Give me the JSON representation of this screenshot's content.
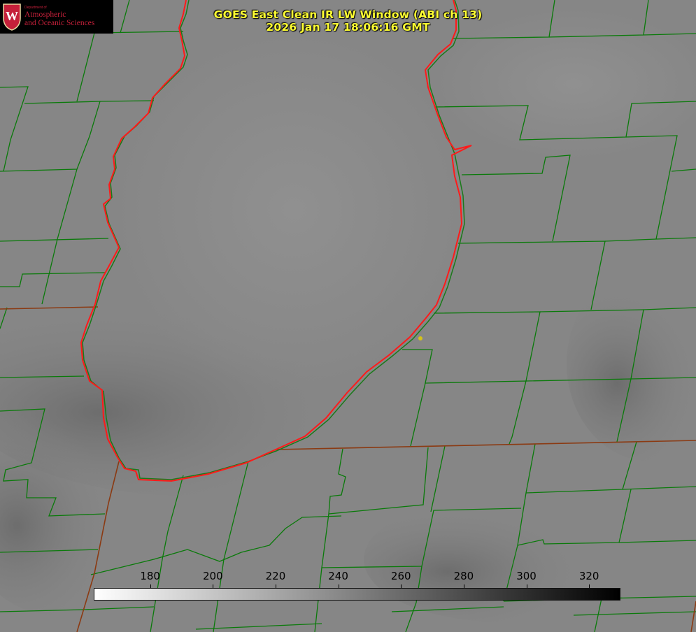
{
  "title": {
    "line1": "GOES East Clean IR LW Window (ABI ch 13)",
    "line2": "2026 Jan 17 18:06:16 GMT"
  },
  "logo": {
    "department": "Department of",
    "line1": "Atmospheric",
    "line2": "and Oceanic Sciences",
    "crest_letter": "W",
    "color": "#c5203a"
  },
  "colorbar": {
    "min": 162,
    "max": 330,
    "ticks": [
      "180",
      "200",
      "220",
      "240",
      "260",
      "280",
      "300",
      "320"
    ],
    "colormap": "white-to-black"
  },
  "map_colors": {
    "boundaries": "#0a7a0a",
    "state_lines": "#8b3a12",
    "lake_outline": "#ff1a1a",
    "marker": "#d4c21a",
    "title": "#ffff33"
  }
}
